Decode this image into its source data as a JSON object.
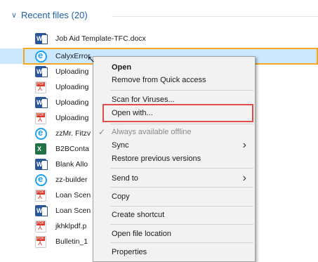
{
  "group": {
    "chevron": "chevron-down-icon",
    "title": "Recent files (20)"
  },
  "files": [
    {
      "icon": "word",
      "name": "Job Aid Template-TFC.docx"
    },
    {
      "icon": "ie",
      "name": "CalyxError"
    },
    {
      "icon": "word",
      "name": "Uploading"
    },
    {
      "icon": "pdf",
      "name": "Uploading"
    },
    {
      "icon": "word",
      "name": "Uploading"
    },
    {
      "icon": "pdf",
      "name": "Uploading"
    },
    {
      "icon": "ie",
      "name": "zzMr. Fitzv"
    },
    {
      "icon": "excel",
      "name": "B2BConta"
    },
    {
      "icon": "word",
      "name": "Blank Allo"
    },
    {
      "icon": "ie",
      "name": "zz-builder"
    },
    {
      "icon": "pdf",
      "name": "Loan Scen"
    },
    {
      "icon": "word",
      "name": "Loan Scen"
    },
    {
      "icon": "pdf",
      "name": "jkhklpdf.p"
    },
    {
      "icon": "pdf",
      "name": "Bulletin_1"
    }
  ],
  "menu": {
    "open": "Open",
    "remove_quick_access": "Remove from Quick access",
    "scan_viruses": "Scan for Viruses...",
    "open_with": "Open with...",
    "always_offline": "Always available offline",
    "sync": "Sync",
    "restore_versions": "Restore previous versions",
    "send_to": "Send to",
    "copy": "Copy",
    "create_shortcut": "Create shortcut",
    "open_location": "Open file location",
    "properties": "Properties"
  },
  "colors": {
    "selection": "#cce8ff",
    "orange_highlight": "#f5a623",
    "red_highlight": "#e04b4b"
  }
}
